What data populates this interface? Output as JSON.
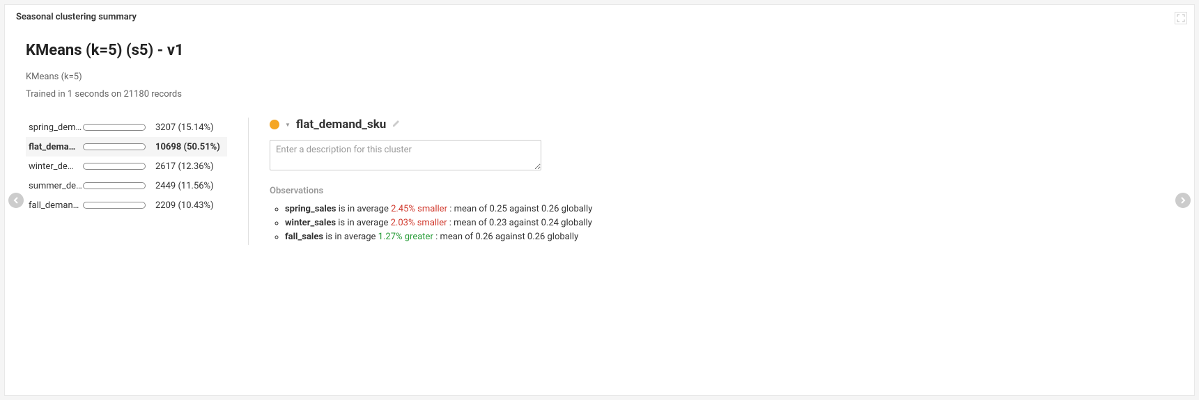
{
  "header": {
    "panel_title": "Seasonal clustering summary"
  },
  "model": {
    "title": "KMeans (k=5) (s5) - v1",
    "subtitle": "KMeans (k=5)",
    "training_info": "Trained in 1 seconds on 21180 records"
  },
  "clusters": [
    {
      "name": "spring_dem…",
      "count": "3207",
      "pct": "15.14%",
      "fill_pct": 15.14,
      "color": "#e74c3c",
      "selected": false
    },
    {
      "name": "flat_dema…",
      "count": "10698",
      "pct": "50.51%",
      "fill_pct": 50.51,
      "color": "#f5a623",
      "selected": true
    },
    {
      "name": "winter_de…",
      "count": "2617",
      "pct": "12.36%",
      "fill_pct": 12.36,
      "color": "#27ae60",
      "selected": false
    },
    {
      "name": "summer_de…",
      "count": "2449",
      "pct": "11.56%",
      "fill_pct": 11.56,
      "color": "#1abc9c",
      "selected": false
    },
    {
      "name": "fall_deman…",
      "count": "2209",
      "pct": "10.43%",
      "fill_pct": 10.43,
      "color": "#2c5aa0",
      "selected": false
    }
  ],
  "detail": {
    "dot_color": "#f5a623",
    "title": "flat_demand_sku",
    "description_placeholder": "Enter a description for this cluster",
    "observations_heading": "Observations",
    "observations": [
      {
        "metric": "spring_sales",
        "mid": " is in average ",
        "delta": "2.45% smaller",
        "dir": "smaller",
        "tail": " : mean of 0.25 against 0.26 globally"
      },
      {
        "metric": "winter_sales",
        "mid": " is in average ",
        "delta": "2.03% smaller",
        "dir": "smaller",
        "tail": " : mean of 0.23 against 0.24 globally"
      },
      {
        "metric": "fall_sales",
        "mid": " is in average ",
        "delta": "1.27% greater",
        "dir": "greater",
        "tail": " : mean of 0.26 against 0.26 globally"
      }
    ]
  }
}
